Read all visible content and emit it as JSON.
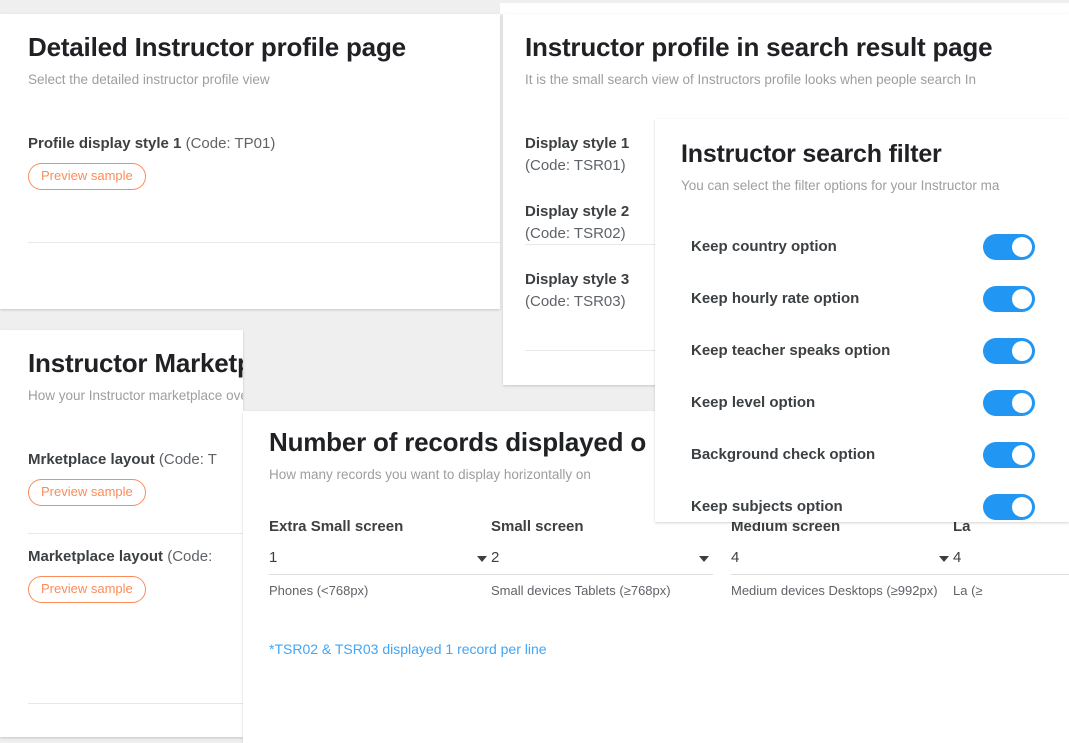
{
  "theme": {
    "page_background": "#efefef",
    "card_background": "#ffffff",
    "accent_orange": "#fb8c5a",
    "toggle_on": "#2196f3",
    "link_blue": "#42a5f5",
    "title_color": "#202124",
    "muted_text": "#9e9e9e"
  },
  "detailed_profile_card": {
    "title": "Detailed Instructor profile page",
    "subtitle": "Select the detailed instructor profile view",
    "rows": [
      {
        "label": "Profile display style 1",
        "code": "(Code: TP01)",
        "button": "Preview sample"
      }
    ]
  },
  "marketplace_card": {
    "title": "Instructor Marketplace Layout",
    "subtitle": "How your Instructor marketplace overall looks",
    "rows": [
      {
        "label": "Mrketplace layout",
        "code": "(Code: T",
        "button": "Preview sample"
      },
      {
        "label": "Marketplace layout",
        "code": "(Code:",
        "button": "Preview sample"
      }
    ]
  },
  "search_result_card": {
    "title": "Instructor profile in search result page",
    "subtitle": "It is the small search view of Instructors profile looks when people search In",
    "styles": [
      {
        "name": "Display style 1",
        "code": "(Code: TSR01)"
      },
      {
        "name": "Display style 2",
        "code": "(Code: TSR02)"
      },
      {
        "name": "Display style 3",
        "code": "(Code: TSR03)"
      }
    ]
  },
  "records_card": {
    "title": "Number of records displayed o",
    "subtitle": "How many records you want to display horizontally on",
    "columns": [
      {
        "title": "Extra Small screen",
        "value": "1",
        "help": "Phones (<768px)"
      },
      {
        "title": "Small screen",
        "value": "2",
        "help": "Small devices Tablets (≥768px)"
      },
      {
        "title": "Medium screen",
        "value": "4",
        "help": "Medium devices Desktops (≥992px)"
      },
      {
        "title": "La",
        "value": "4",
        "help": "La (≥"
      }
    ],
    "note": "*TSR02 & TSR03 displayed 1 record per line"
  },
  "search_filter_card": {
    "title": "Instructor search filter",
    "subtitle": "You can select the filter options for your Instructor ma",
    "options": [
      {
        "label": "Keep country option",
        "enabled": true
      },
      {
        "label": "Keep hourly rate option",
        "enabled": true
      },
      {
        "label": "Keep teacher speaks option",
        "enabled": true
      },
      {
        "label": "Keep level option",
        "enabled": true
      },
      {
        "label": "Background check option",
        "enabled": true
      },
      {
        "label": "Keep subjects option",
        "enabled": true
      }
    ]
  }
}
